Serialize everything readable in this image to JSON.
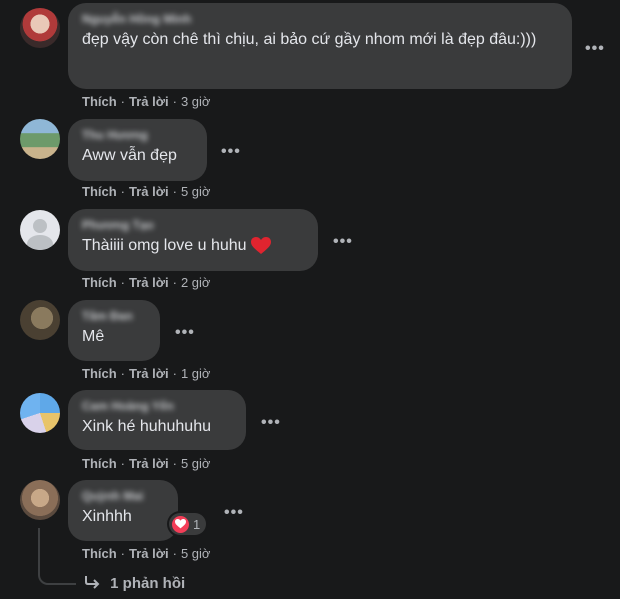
{
  "comments": [
    {
      "author": "Nguyễn Hồng Minh",
      "text": "đẹp vậy còn chê thì chịu, ai bảo cứ gầy nhom mới là đẹp đâu:)))",
      "like": "Thích",
      "reply": "Trả lời",
      "time": "3 giờ"
    },
    {
      "author": "Thu Hương",
      "text": "Aww vẫn đẹp",
      "like": "Thích",
      "reply": "Trả lời",
      "time": "5 giờ"
    },
    {
      "author": "Phương Tạo",
      "text": "Thàiiii omg love u huhu",
      "like": "Thích",
      "reply": "Trả lời",
      "time": "2 giờ"
    },
    {
      "author": "Tâm Đan",
      "text": "Mê",
      "like": "Thích",
      "reply": "Trả lời",
      "time": "1 giờ"
    },
    {
      "author": "Cam Hoàng Yến",
      "text": "Xink hé huhuhuhu",
      "like": "Thích",
      "reply": "Trả lời",
      "time": "5 giờ"
    },
    {
      "author": "Quỳnh Mai",
      "text": "Xinhhh",
      "like": "Thích",
      "reply": "Trả lời",
      "time": "5 giờ",
      "reaction_count": "1"
    }
  ],
  "replies_label": "1 phản hồi",
  "more_glyph": "•••",
  "colors": {
    "background": "#18191a",
    "bubble": "#3a3b3c",
    "text": "#e4e6eb",
    "muted": "#b0b3b8",
    "heart": "#f33e58"
  }
}
